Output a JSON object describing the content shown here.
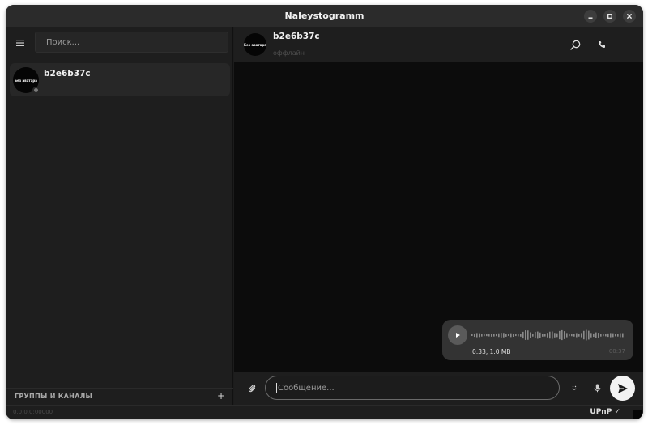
{
  "window": {
    "title": "Naleystogramm"
  },
  "icons": {
    "minimize": "minimize-icon",
    "maximize": "maximize-icon",
    "close": "close-icon",
    "menu": "hamburger-menu-icon",
    "search": "search-icon",
    "call": "phone-icon",
    "play": "play-icon",
    "attach": "paperclip-icon",
    "emoji": "emoji-icon",
    "mic": "microphone-icon",
    "send": "send-icon",
    "add": "plus-icon"
  },
  "sidebar": {
    "search_placeholder": "Поиск...",
    "chats": [
      {
        "name": "b2e6b37c",
        "avatar_text": "Без аватара"
      }
    ],
    "groups_label": "ГРУППЫ И КАНАЛЫ",
    "add_label": "+"
  },
  "chat": {
    "name": "b2e6b37c",
    "status": "оффлайн",
    "avatar_text": "Без аватара"
  },
  "messages": [
    {
      "type": "voice",
      "info": "0:33, 1.0 MB",
      "time": "00:37"
    }
  ],
  "composer": {
    "placeholder": "Сообщение..."
  },
  "statusbar": {
    "address": "0.0.0.0:00000",
    "upnp": "UPnP ✓"
  },
  "colors": {
    "window_bg": "#1c1c1c",
    "titlebar_bg": "#2b2b2b",
    "messages_bg": "#0c0c0c",
    "bubble_bg": "#333333",
    "send_button_bg": "#f2f2f2"
  }
}
